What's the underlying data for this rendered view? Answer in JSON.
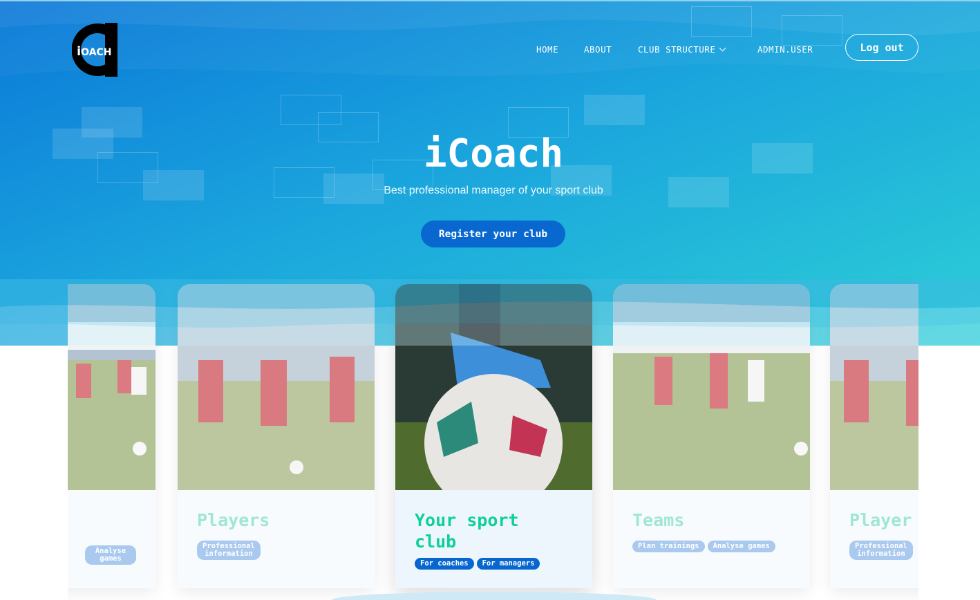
{
  "brand": {
    "logo_letter": "i",
    "logo_word": "OACH"
  },
  "nav": {
    "home": "HOME",
    "about": "ABOUT",
    "club_structure": "CLUB STRUCTURE",
    "admin_user": "ADMIN.USER",
    "logout": "Log out"
  },
  "hero": {
    "title": "iCoach",
    "subtitle": "Best professional manager of your sport club",
    "cta": "Register your club"
  },
  "cards": [
    {
      "title": "",
      "tags": [
        "Analyse games"
      ],
      "faded": true
    },
    {
      "title": "Players",
      "tags": [
        "Professional\ninformation"
      ],
      "faded": true
    },
    {
      "title": "Your sport club",
      "tags": [
        "For coaches",
        "For managers"
      ],
      "faded": false
    },
    {
      "title": "Teams",
      "tags": [
        "Plan trainings",
        "Analyse games"
      ],
      "faded": true
    },
    {
      "title": "Player",
      "tags": [
        "Professional\ninformation"
      ],
      "faded": true
    }
  ],
  "colors": {
    "accent": "#0866cf",
    "title_green": "#0fcf9a",
    "hero_start": "#0a78d8",
    "hero_end": "#2ccfd6"
  }
}
